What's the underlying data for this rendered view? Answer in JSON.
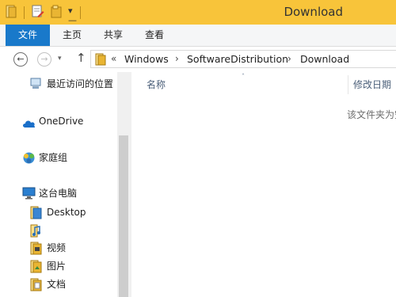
{
  "window": {
    "title": "Download"
  },
  "quick_access": {
    "icons": [
      "folder-icon",
      "properties-icon",
      "new-folder-icon",
      "customize-dropdown-icon"
    ]
  },
  "ribbon": {
    "tabs": [
      {
        "label": "文件"
      },
      {
        "label": "主页"
      },
      {
        "label": "共享"
      },
      {
        "label": "查看"
      }
    ]
  },
  "address": {
    "overflow": "«",
    "segments": [
      "Windows",
      "SoftwareDistribution",
      "Download"
    ],
    "separator": "›"
  },
  "nav_pane": {
    "items": [
      {
        "label": "最近访问的位置",
        "icon": "recent-places-icon"
      },
      {
        "label": "OneDrive",
        "icon": "onedrive-cloud-icon"
      },
      {
        "label": "家庭组",
        "icon": "homegroup-icon"
      },
      {
        "label": "这台电脑",
        "icon": "this-pc-icon"
      },
      {
        "label": "Desktop",
        "icon": "folder-icon"
      },
      {
        "label": "",
        "icon": "music-icon"
      },
      {
        "label": "视频",
        "icon": "folder-icon"
      },
      {
        "label": "图片",
        "icon": "folder-icon"
      },
      {
        "label": "文档",
        "icon": "folder-icon"
      }
    ]
  },
  "content": {
    "columns": [
      {
        "label": "名称"
      },
      {
        "label": "修改日期"
      }
    ],
    "empty_message": "该文件夹为空。"
  },
  "colors": {
    "title_bar": "#f8c43a",
    "file_tab": "#1979ca",
    "column_header_text": "#4c607a"
  }
}
